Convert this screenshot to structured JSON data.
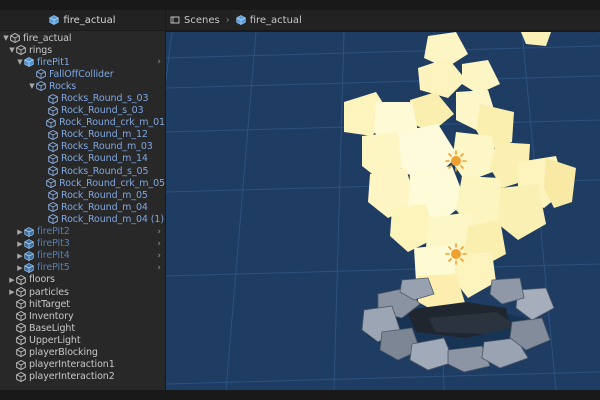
{
  "hierarchy": {
    "header_title": "fire_actual",
    "rows": [
      {
        "label": "fire_actual",
        "indent": 0,
        "arrow": "down",
        "style": "normal",
        "chevron": false
      },
      {
        "label": "rings",
        "indent": 1,
        "arrow": "down",
        "style": "normal",
        "chevron": false
      },
      {
        "label": "firePit1",
        "indent": 2,
        "arrow": "down",
        "style": "prefab",
        "chevron": true
      },
      {
        "label": "FallOffCollider",
        "indent": 3,
        "arrow": "",
        "style": "prefab",
        "chevron": false
      },
      {
        "label": "Rocks",
        "indent": 3,
        "arrow": "down",
        "style": "prefab",
        "chevron": false
      },
      {
        "label": "Rocks_Round_s_03",
        "indent": 4,
        "arrow": "",
        "style": "prefab",
        "chevron": false
      },
      {
        "label": "Rock_Round_s_03",
        "indent": 4,
        "arrow": "",
        "style": "prefab",
        "chevron": false
      },
      {
        "label": "Rock_Round_crk_m_01",
        "indent": 4,
        "arrow": "",
        "style": "prefab",
        "chevron": false
      },
      {
        "label": "Rock_Round_m_12",
        "indent": 4,
        "arrow": "",
        "style": "prefab",
        "chevron": false
      },
      {
        "label": "Rocks_Round_m_03",
        "indent": 4,
        "arrow": "",
        "style": "prefab",
        "chevron": false
      },
      {
        "label": "Rock_Round_m_14",
        "indent": 4,
        "arrow": "",
        "style": "prefab",
        "chevron": false
      },
      {
        "label": "Rocks_Round_s_05",
        "indent": 4,
        "arrow": "",
        "style": "prefab",
        "chevron": false
      },
      {
        "label": "Rock_Round_crk_m_05",
        "indent": 4,
        "arrow": "",
        "style": "prefab",
        "chevron": false
      },
      {
        "label": "Rock_Round_m_05",
        "indent": 4,
        "arrow": "",
        "style": "prefab",
        "chevron": false
      },
      {
        "label": "Rock_Round_m_04",
        "indent": 4,
        "arrow": "",
        "style": "prefab",
        "chevron": false
      },
      {
        "label": "Rock_Round_m_04 (1)",
        "indent": 4,
        "arrow": "",
        "style": "prefab",
        "chevron": false
      },
      {
        "label": "firePit2",
        "indent": 2,
        "arrow": "right",
        "style": "prefab-dim",
        "chevron": true
      },
      {
        "label": "firePit3",
        "indent": 2,
        "arrow": "right",
        "style": "prefab-dim",
        "chevron": true
      },
      {
        "label": "firePit4",
        "indent": 2,
        "arrow": "right",
        "style": "prefab-dim",
        "chevron": true
      },
      {
        "label": "firePit5",
        "indent": 2,
        "arrow": "right",
        "style": "prefab-dim",
        "chevron": true
      },
      {
        "label": "floors",
        "indent": 1,
        "arrow": "right",
        "style": "normal",
        "chevron": false
      },
      {
        "label": "particles",
        "indent": 1,
        "arrow": "right",
        "style": "normal",
        "chevron": false
      },
      {
        "label": "hitTarget",
        "indent": 1,
        "arrow": "",
        "style": "normal",
        "chevron": false
      },
      {
        "label": "Inventory",
        "indent": 1,
        "arrow": "",
        "style": "normal",
        "chevron": false
      },
      {
        "label": "BaseLight",
        "indent": 1,
        "arrow": "",
        "style": "normal",
        "chevron": false
      },
      {
        "label": "UpperLight",
        "indent": 1,
        "arrow": "",
        "style": "normal",
        "chevron": false
      },
      {
        "label": "playerBlocking",
        "indent": 1,
        "arrow": "",
        "style": "normal",
        "chevron": false
      },
      {
        "label": "playerInteraction1",
        "indent": 1,
        "arrow": "",
        "style": "normal",
        "chevron": false
      },
      {
        "label": "playerInteraction2",
        "indent": 1,
        "arrow": "",
        "style": "normal",
        "chevron": false
      }
    ]
  },
  "scene": {
    "breadcrumb_root": "Scenes",
    "breadcrumb_current": "fire_actual"
  },
  "colors": {
    "scene_bg": "#1f3d63",
    "grid": "#2f5687",
    "flame": "#fdf6c4",
    "flame_shadow": "#e8dc92",
    "light_icon": "#f0a030",
    "prefab_text": "#7fa7e0"
  },
  "icons": {
    "gameobject": "cube-icon",
    "scenes": "scenes-icon",
    "light": "point-light-icon"
  }
}
